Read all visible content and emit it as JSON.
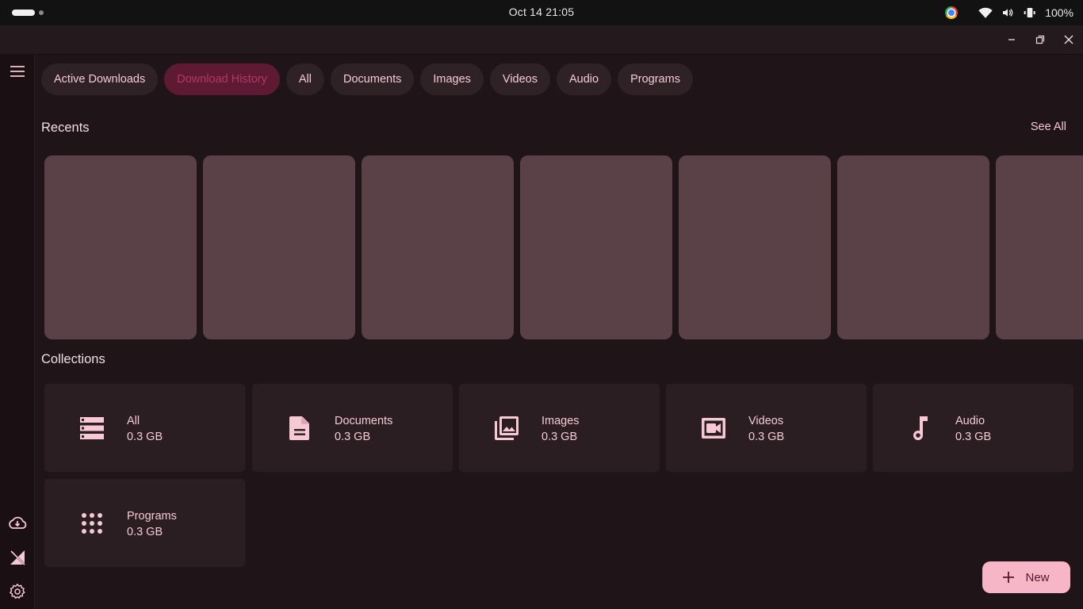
{
  "system": {
    "clock": "Oct 14  21:05",
    "battery": "100%",
    "icons": [
      "chrome-icon",
      "wifi-icon",
      "volume-icon",
      "battery-icon"
    ]
  },
  "theme": {
    "background": "#1f1417",
    "chip_bg": "#2f2226",
    "chip_active_bg": "#5e1a33",
    "chip_active_text": "#b2385f",
    "accent": "#f7b6c8",
    "card_bg": "#2b1e22",
    "recent_card_bg": "#5a4047"
  },
  "tabs": [
    {
      "label": "Active Downloads",
      "active": false
    },
    {
      "label": "Download History",
      "active": true
    },
    {
      "label": "All",
      "active": false
    },
    {
      "label": "Documents",
      "active": false
    },
    {
      "label": "Images",
      "active": false
    },
    {
      "label": "Videos",
      "active": false
    },
    {
      "label": "Audio",
      "active": false
    },
    {
      "label": "Programs",
      "active": false
    }
  ],
  "recents": {
    "title": "Recents",
    "see_all": "See All",
    "count": 7
  },
  "collections": {
    "title": "Collections",
    "items": [
      {
        "name": "All",
        "size": "0.3 GB",
        "icon": "storage-icon"
      },
      {
        "name": "Documents",
        "size": "0.3 GB",
        "icon": "document-icon"
      },
      {
        "name": "Images",
        "size": "0.3 GB",
        "icon": "photo-library-icon"
      },
      {
        "name": "Videos",
        "size": "0.3 GB",
        "icon": "video-icon"
      },
      {
        "name": "Audio",
        "size": "0.3 GB",
        "icon": "music-note-icon"
      },
      {
        "name": "Programs",
        "size": "0.3 GB",
        "icon": "apps-grid-icon"
      }
    ]
  },
  "fab": {
    "label": "New",
    "icon": "plus-icon"
  },
  "rail": {
    "icons": [
      "menu-icon",
      "cloud-download-icon",
      "signal-off-icon",
      "gear-icon"
    ]
  }
}
